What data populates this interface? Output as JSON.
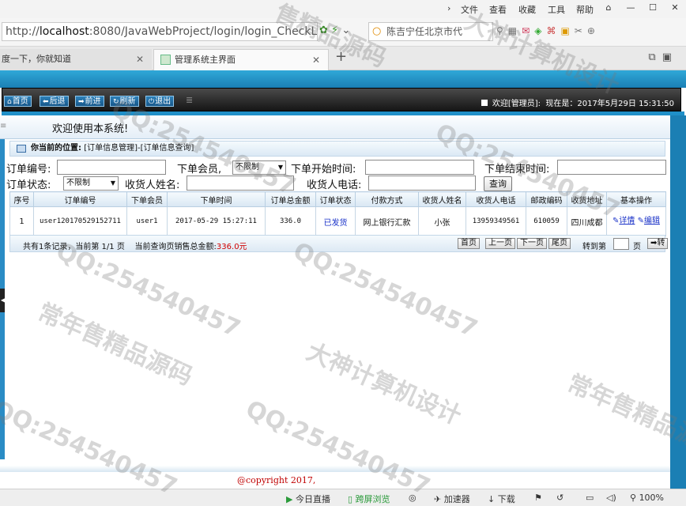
{
  "browser": {
    "menu": [
      "文件",
      "查看",
      "收藏",
      "工具",
      "帮助"
    ],
    "url_prefix": "http://",
    "url_host": "localhost",
    "url_rest": ":8080/JavaWebProject/login/login_CheckLog",
    "search_text": "陈吉宁任北京市代",
    "tabs": [
      {
        "label": "度一下，你就知道"
      },
      {
        "label": "管理系统主界面"
      }
    ],
    "new_tab": "+"
  },
  "nav": {
    "buttons": [
      "首页",
      "后退",
      "前进",
      "刷新",
      "退出"
    ],
    "welcome_user": "欢迎[管理员]:",
    "now_label": "现在是：2017年5月29日 15:31:50"
  },
  "welcome_text": "欢迎使用本系统!",
  "location": {
    "label": "你当前的位置:",
    "path": "[订单信息管理]-[订单信息查询]"
  },
  "search_form": {
    "order_no_label": "订单编号:",
    "member_label": "下单会员,",
    "member_value": "不限制",
    "start_time_label": "下单开始时间:",
    "end_time_label": "下单结束时间:",
    "status_label": "订单状态:",
    "status_value": "不限制",
    "receiver_name_label": "收货人姓名:",
    "receiver_phone_label": "收货人电话:",
    "query_button": "查询"
  },
  "table": {
    "headers": [
      "序号",
      "订单编号",
      "下单会员",
      "下单时间",
      "订单总金额",
      "订单状态",
      "付款方式",
      "收货人姓名",
      "收货人电话",
      "邮政编码",
      "收货地址",
      "基本操作"
    ],
    "rows": [
      {
        "no": "1",
        "order_no": "user120170529152711",
        "member": "user1",
        "time": "2017-05-29 15:27:11",
        "amount": "336.0",
        "status": "已发货",
        "payment": "网上银行汇款",
        "receiver": "小张",
        "phone": "13959349561",
        "zip": "610059",
        "address": "四川成都",
        "op_detail": "详情",
        "op_edit": "编辑"
      }
    ]
  },
  "pager": {
    "info": "共有1条记录，当前第 1/1 页",
    "sales_label": "当前查询页销售总金额:",
    "sales_amount": "336.0元",
    "first": "首页",
    "prev": "上一页",
    "next": "下一页",
    "last": "尾页",
    "goto_label": "转到第",
    "page_unit": "页",
    "go_button": "转"
  },
  "footer": {
    "copyright": "@copyright 2017,"
  },
  "statusbar": {
    "live": "今日直播",
    "speed_view": "跨屏浏览",
    "accelerator": "加速器",
    "download": "下载",
    "zoom": "100%"
  },
  "watermarks": [
    "售精品源码",
    "大神计算机设计",
    "QQ:254540457",
    "常年售精品源码"
  ]
}
